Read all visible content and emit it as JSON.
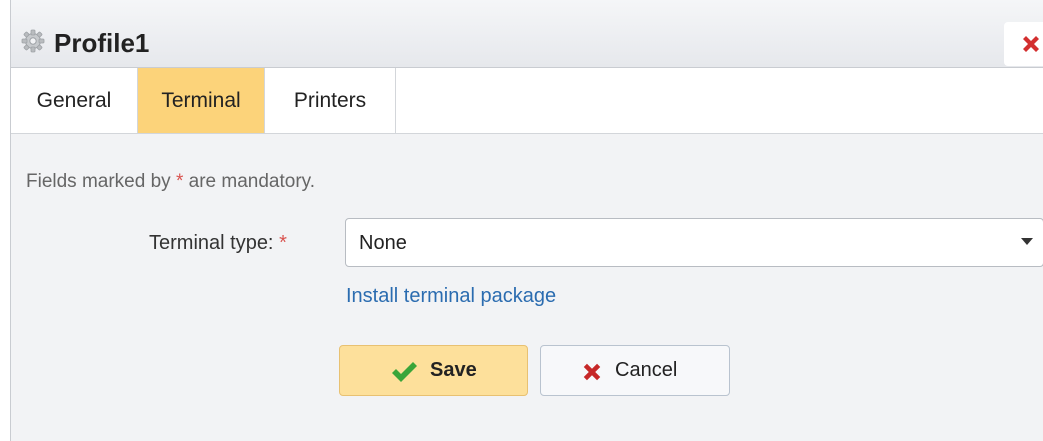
{
  "window": {
    "title": "Profile1",
    "title_icon": "gear-icon",
    "close_icon": "close-icon"
  },
  "tabs": [
    {
      "label": "General",
      "active": false
    },
    {
      "label": "Terminal",
      "active": true
    },
    {
      "label": "Printers",
      "active": false
    }
  ],
  "form": {
    "mandatory_note_prefix": "Fields marked by ",
    "required_marker": "*",
    "mandatory_note_suffix": " are mandatory.",
    "terminal_type_label": "Terminal type: ",
    "terminal_type_value": "None",
    "install_link": "Install terminal package"
  },
  "buttons": {
    "save_label": "Save",
    "save_icon": "checkmark-icon",
    "cancel_label": "Cancel",
    "cancel_icon": "close-icon"
  },
  "colors": {
    "active_tab": "#fcd37a",
    "save_button": "#fde09b",
    "required": "#d9534f",
    "link": "#2b6cb0",
    "check": "#3aa53a",
    "close_x": "#d32f2f"
  }
}
